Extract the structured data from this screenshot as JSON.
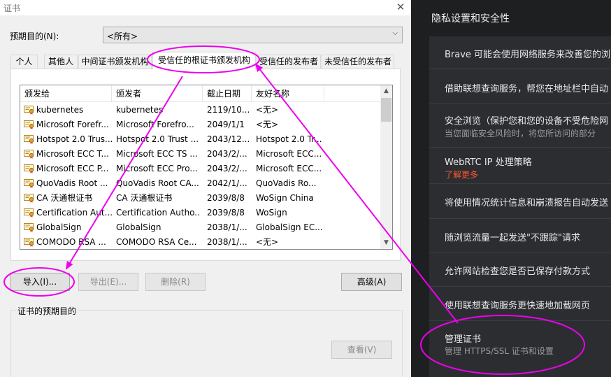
{
  "dialog": {
    "title": "证书",
    "close_glyph": "✕",
    "purpose_label": "预期目的(N):",
    "purpose_value": "<所有>",
    "tabs": [
      {
        "label": "个人"
      },
      {
        "label": "其他人"
      },
      {
        "label": "中间证书颁发机构"
      },
      {
        "label": "受信任的根证书颁发机构"
      },
      {
        "label": "受信任的发布者"
      },
      {
        "label": "未受信任的发布者"
      }
    ],
    "columns": [
      "颁发给",
      "颁发者",
      "截止日期",
      "友好名称"
    ],
    "rows": [
      [
        "kubernetes",
        "kubernetes",
        "2119/10...",
        "<无>"
      ],
      [
        "Microsoft Forefr...",
        "Microsoft Forefro...",
        "2049/1/1",
        "<无>"
      ],
      [
        "Hotspot 2.0 Trus...",
        "Hotspot 2.0 Trust ...",
        "2043/12...",
        "Hotspot 2.0 Tr..."
      ],
      [
        "Microsoft ECC T...",
        "Microsoft ECC TS ...",
        "2043/2/...",
        "Microsoft ECC..."
      ],
      [
        "Microsoft ECC P...",
        "Microsoft ECC Pro...",
        "2043/2/...",
        "Microsoft ECC..."
      ],
      [
        "QuoVadis Root ...",
        "QuoVadis Root CA...",
        "2042/1/...",
        "QuoVadis Ro..."
      ],
      [
        "CA 沃通根证书",
        "CA 沃通根证书",
        "2039/8/8",
        "WoSign China"
      ],
      [
        "Certification Aut...",
        "Certification Autho...",
        "2039/8/8",
        "WoSign"
      ],
      [
        "GlobalSign",
        "GlobalSign",
        "2038/1/...",
        "GlobalSign EC..."
      ],
      [
        "COMODO RSA ...",
        "COMODO RSA Ce...",
        "2038/1/...",
        "<无>"
      ]
    ],
    "buttons": {
      "import": "导入(I)...",
      "export": "导出(E)...",
      "remove": "删除(R)",
      "advanced": "高级(A)",
      "view": "查看(V)"
    },
    "purposes_group_label": "证书的预期目的"
  },
  "settings": {
    "title": "隐私设置和安全性",
    "items": [
      {
        "title": "Brave 可能会使用网络服务来改善您的浏"
      },
      {
        "title": "借助联想查询服务，帮您在地址栏中自动"
      },
      {
        "title": "安全浏览（保护您和您的设备不受危险网",
        "subtitle": "当您面临安全风险时，将您所访问的部分"
      },
      {
        "title": "WebRTC IP 处理策略",
        "link": "了解更多"
      },
      {
        "title": "将使用情况统计信息和崩溃报告自动发送"
      },
      {
        "title": "随浏览流量一起发送\"不跟踪\"请求"
      },
      {
        "title": "允许网站检查您是否已保存付款方式"
      },
      {
        "title": "使用联想查询服务更快速地加载网页"
      },
      {
        "title": "管理证书",
        "subtitle": "管理 HTTPS/SSL 证书和设置"
      }
    ]
  },
  "colors": {
    "annotation": "#ee00ee",
    "settings_bg": "#1e1f21",
    "settings_card": "#2c2d31",
    "link": "#ff5533"
  }
}
